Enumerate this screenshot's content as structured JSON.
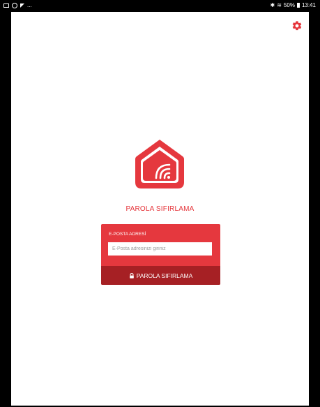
{
  "status_bar": {
    "left_icons": [
      "gallery-icon",
      "location-icon",
      "flag-icon"
    ],
    "left_more": "...",
    "bluetooth": "✱",
    "signal": "≋",
    "battery_text": "50%",
    "time": "13:41"
  },
  "colors": {
    "brand_red": "#e5383e",
    "button_dark_red": "#a62024",
    "background": "#ffffff"
  },
  "page": {
    "title": "PAROLA SIFIRLAMA",
    "settings_icon": "gear-icon",
    "logo_icon": "smart-home-logo-icon"
  },
  "form": {
    "email_label": "E-POSTA ADRESİ",
    "email_placeholder": "E-Posta adresinizi giriniz",
    "email_value": "",
    "submit_icon": "lock-icon",
    "submit_label": "PAROLA SIFIRLAMA"
  }
}
